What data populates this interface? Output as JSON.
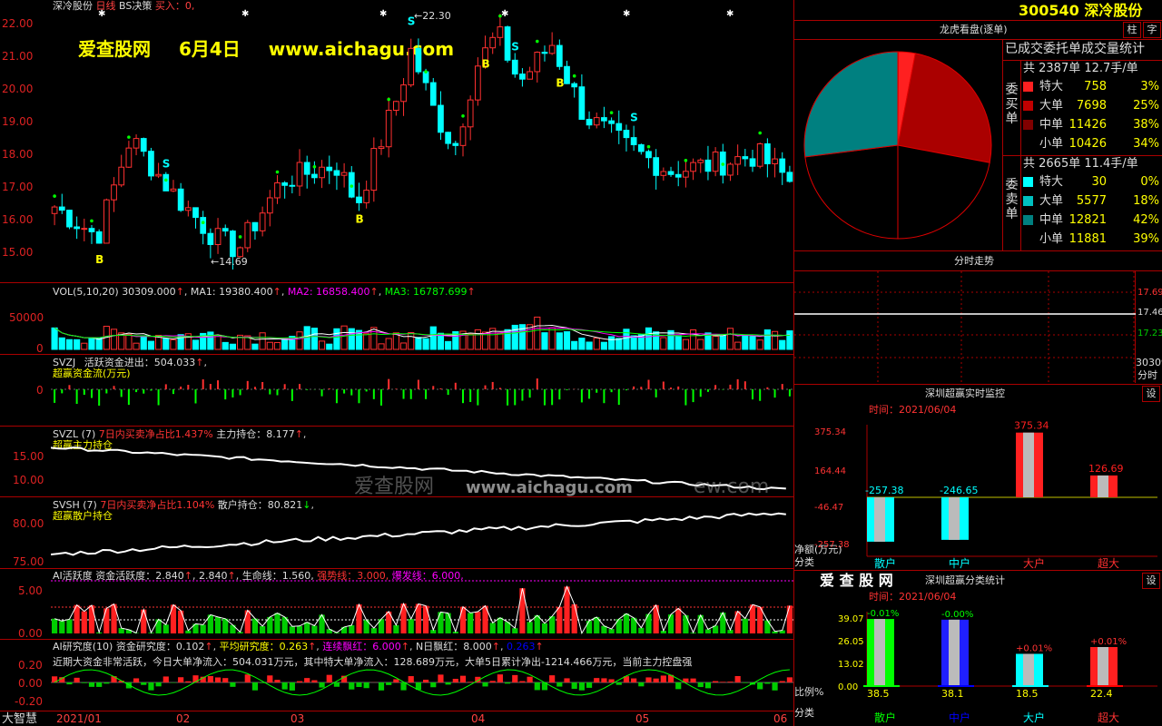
{
  "header": {
    "stock_name": "深冷股份",
    "period": "日线",
    "bs": "BS决策",
    "buy_in": "买入：0,",
    "code": "300540",
    "name": "深冷股份",
    "btn_zhu": "柱",
    "btn_zi": "字"
  },
  "watermark": {
    "site": "爱查股网",
    "date": "6月4日",
    "url": "www.aichagu.com",
    "faded": "爱查股网",
    "faded_url": "www.aichagu.com",
    "faded_tail": "ew.com"
  },
  "main_chart": {
    "y_ticks": [
      "22.00",
      "21.00",
      "20.00",
      "19.00",
      "18.00",
      "17.00",
      "16.00",
      "15.00"
    ],
    "high_label": "22.30",
    "low_label": "14.69",
    "buy_mark": "B",
    "sell_mark": "S"
  },
  "vol": {
    "label": "VOL(5,10,20)",
    "value": "30309.000",
    "ma1": "MA1: 19380.400",
    "ma2": "MA2: 16858.400",
    "ma3": "MA3: 16787.699",
    "ticks": [
      "50000",
      "0"
    ]
  },
  "svzj": {
    "label": "SVZJ",
    "title": "活跃资金进出：504.033",
    "sub": "超赢资金流(万元)",
    "ticks": [
      "0"
    ]
  },
  "svzl": {
    "label": "SVZL (7)",
    "ratio": "7日内买卖净占比1.437%",
    "hold": "主力持仓：8.177",
    "sub": "超赢主力持仓",
    "ticks": [
      "15.00",
      "10.00"
    ]
  },
  "svsh": {
    "label": "SVSH (7)",
    "ratio": "7日内买卖净占比1.104%",
    "hold": "散户持仓：80.821",
    "sub": "超赢散户持仓",
    "ticks": [
      "80.00",
      "75.00"
    ]
  },
  "ai_active": {
    "label": "AI活跃度",
    "v1": "资金活跃度：2.840",
    "v2": "2.840",
    "life": "生命线：1.560,",
    "strong": "强势线：3.000,",
    "burst": "爆发线：6.000,",
    "ticks": [
      "5.00",
      "0.00"
    ]
  },
  "ai_research": {
    "label": "AI研究度(10)",
    "v1": "资金研究度：0.102",
    "avg": "平均研究度：0.263",
    "lian": "连续飘红：6.000",
    "n": "N日飘红：8.000",
    "v3": "0.263",
    "summary": "近期大资金非常活跃，今日大单净流入：504.031万元，其中特大单净流入：128.689万元，大单5日累计净出-1214.466万元，当前主力控盘强",
    "ticks": [
      "0.20",
      "0.00",
      "-0.20"
    ]
  },
  "xaxis": {
    "brand": "大智慧",
    "labels": [
      "2021/01",
      "02",
      "03",
      "04",
      "05",
      "06"
    ]
  },
  "dragon": {
    "title": "龙虎看盘(逐单)",
    "subtitle": "已成交委托单成交量统计",
    "buy_side": "委买单",
    "sell_side": "委卖单",
    "buy_total": "共 2387单 12.7手/单",
    "sell_total": "共 2665单 11.4手/单",
    "buy_rows": [
      {
        "label": "特大",
        "count": "758",
        "pct": "3%",
        "color": "#ff2020"
      },
      {
        "label": "大单",
        "count": "7698",
        "pct": "25%",
        "color": "#c00000"
      },
      {
        "label": "中单",
        "count": "11426",
        "pct": "38%",
        "color": "#800000"
      },
      {
        "label": "小单",
        "count": "10426",
        "pct": "34%",
        "color": "#000000"
      }
    ],
    "sell_rows": [
      {
        "label": "特大",
        "count": "30",
        "pct": "0%",
        "color": "#00ffff"
      },
      {
        "label": "大单",
        "count": "5577",
        "pct": "18%",
        "color": "#00c0c0"
      },
      {
        "label": "中单",
        "count": "12821",
        "pct": "42%",
        "color": "#008080"
      },
      {
        "label": "小单",
        "count": "11881",
        "pct": "39%",
        "color": "#000000"
      }
    ]
  },
  "intraday": {
    "title": "分时走势",
    "ticks": [
      "17.69",
      "17.46",
      "17.23"
    ],
    "vol": "30309",
    "vol_unit": "分时"
  },
  "monitor": {
    "title": "深圳超赢实时监控",
    "btn": "设",
    "time": "时间：2021/06/04",
    "y_ticks": [
      "375.34",
      "164.44",
      "-46.47",
      "-257.38"
    ],
    "y_name": "净额(万元)",
    "x_name": "分类",
    "cats": [
      "散户",
      "中户",
      "大户",
      "超大"
    ],
    "values": [
      "-257.38",
      "-246.65",
      "375.34",
      "126.69"
    ]
  },
  "classify": {
    "brand": "爱 查 股 网",
    "title": "深圳超赢分类统计",
    "btn": "设",
    "time": "时间：2021/06/04",
    "y_ticks": [
      "39.07",
      "26.05",
      "13.02",
      "0.00"
    ],
    "y_name": "比例%",
    "x_name": "分类",
    "cats": [
      "散户",
      "中户",
      "大户",
      "超大"
    ],
    "changes": [
      "-0.01%",
      "-0.00%",
      "+0.01%",
      "+0.01%"
    ],
    "values": [
      "38.5",
      "38.1",
      "18.5",
      "22.4"
    ]
  }
}
